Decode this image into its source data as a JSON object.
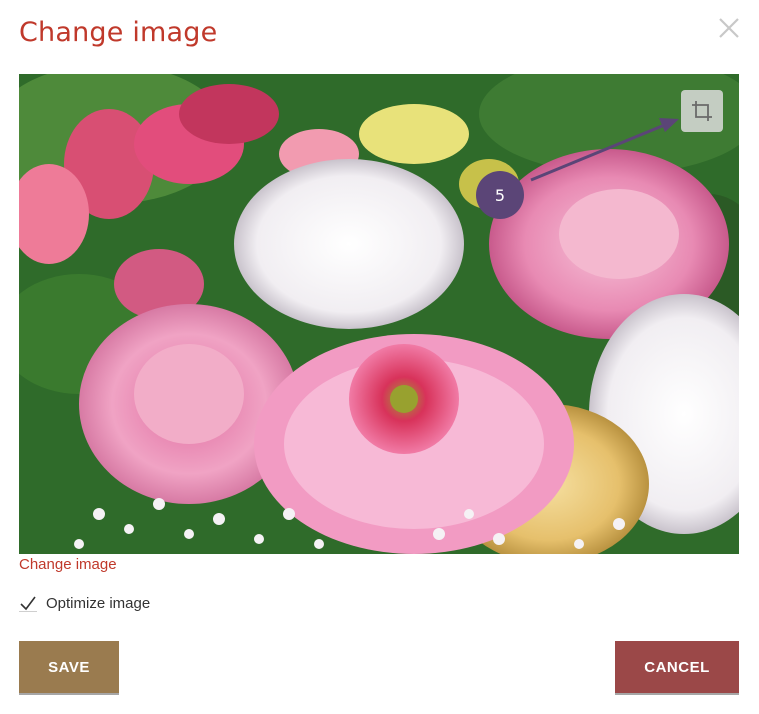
{
  "dialog": {
    "title": "Change image",
    "close_icon": "close-icon"
  },
  "image": {
    "description_icon": "photo",
    "crop_icon": "crop-icon"
  },
  "tutorial": {
    "step_number": "5",
    "color": "#5b4577"
  },
  "links": {
    "change_image": "Change image"
  },
  "options": {
    "optimize_label": "Optimize image",
    "optimize_checked": true
  },
  "buttons": {
    "save_label": "SAVE",
    "cancel_label": "CANCEL"
  },
  "colors": {
    "title": "#c0392b",
    "save": "#9a7b4f",
    "cancel": "#9b4848"
  }
}
